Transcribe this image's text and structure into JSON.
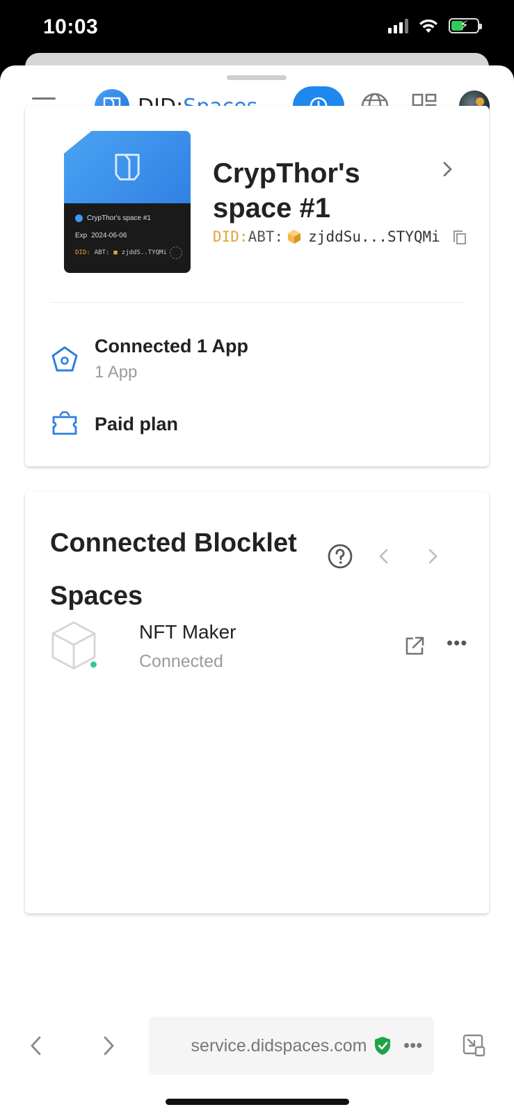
{
  "status_bar": {
    "time": "10:03"
  },
  "header": {
    "logo_prefix": "DID",
    "logo_separator": ":",
    "logo_suffix": "Spaces",
    "accent_color": "#1e88ee"
  },
  "space_card": {
    "title": "CrypThor's space #1",
    "did_prefix": "DID:",
    "did_type": "ABT:",
    "did_short": "zjddSu...STYQMi",
    "nft": {
      "name": "CrypThor's space #1",
      "exp_label": "Exp",
      "exp_date": "2024-06-06",
      "did_prefix": "DID:",
      "did_type": "ABT:",
      "did_short": "zjddS..TYQMi"
    },
    "connected_apps_title": "Connected 1 App",
    "connected_apps_sub": "1 App",
    "plan_label": "Paid plan"
  },
  "blocklet_spaces": {
    "title": "Connected Blocklet Spaces",
    "apps": [
      {
        "name": "NFT Maker",
        "status": "Connected",
        "status_color": "#2ecc8b"
      }
    ]
  },
  "browser": {
    "url": "service.didspaces.com"
  }
}
